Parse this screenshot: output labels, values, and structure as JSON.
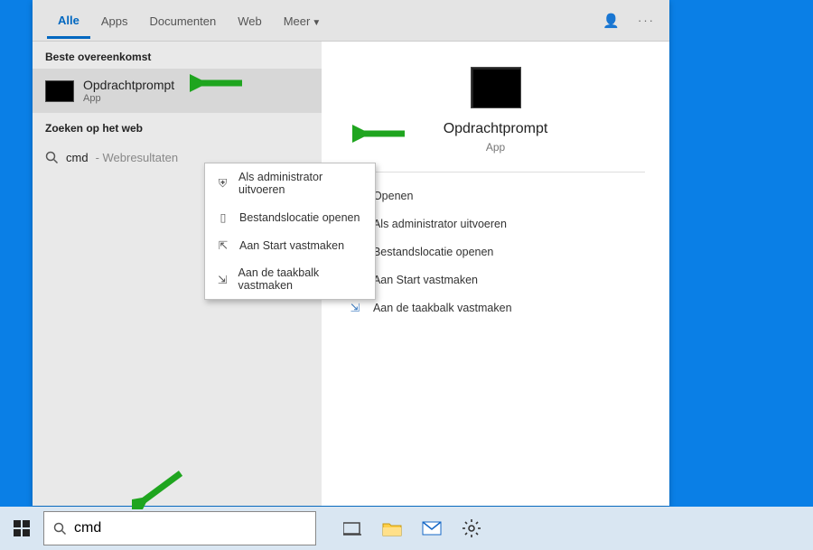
{
  "tabs": {
    "all": "Alle",
    "apps": "Apps",
    "documents": "Documenten",
    "web": "Web",
    "more": "Meer"
  },
  "sections": {
    "best_match": "Beste overeenkomst",
    "search_web": "Zoeken op het web"
  },
  "best": {
    "title": "Opdrachtprompt",
    "subtitle": "App"
  },
  "web_result": {
    "query": "cmd",
    "suffix": " - Webresultaten"
  },
  "context_menu": {
    "run_admin": "Als administrator uitvoeren",
    "open_location": "Bestandslocatie openen",
    "pin_start": "Aan Start vastmaken",
    "pin_taskbar": "Aan de taakbalk vastmaken"
  },
  "detail": {
    "title": "Opdrachtprompt",
    "subtitle": "App",
    "open": "Openen",
    "run_admin": "Als administrator uitvoeren",
    "open_location": "Bestandslocatie openen",
    "pin_start": "Aan Start vastmaken",
    "pin_taskbar": "Aan de taakbalk vastmaken"
  },
  "search": {
    "value": "cmd"
  }
}
